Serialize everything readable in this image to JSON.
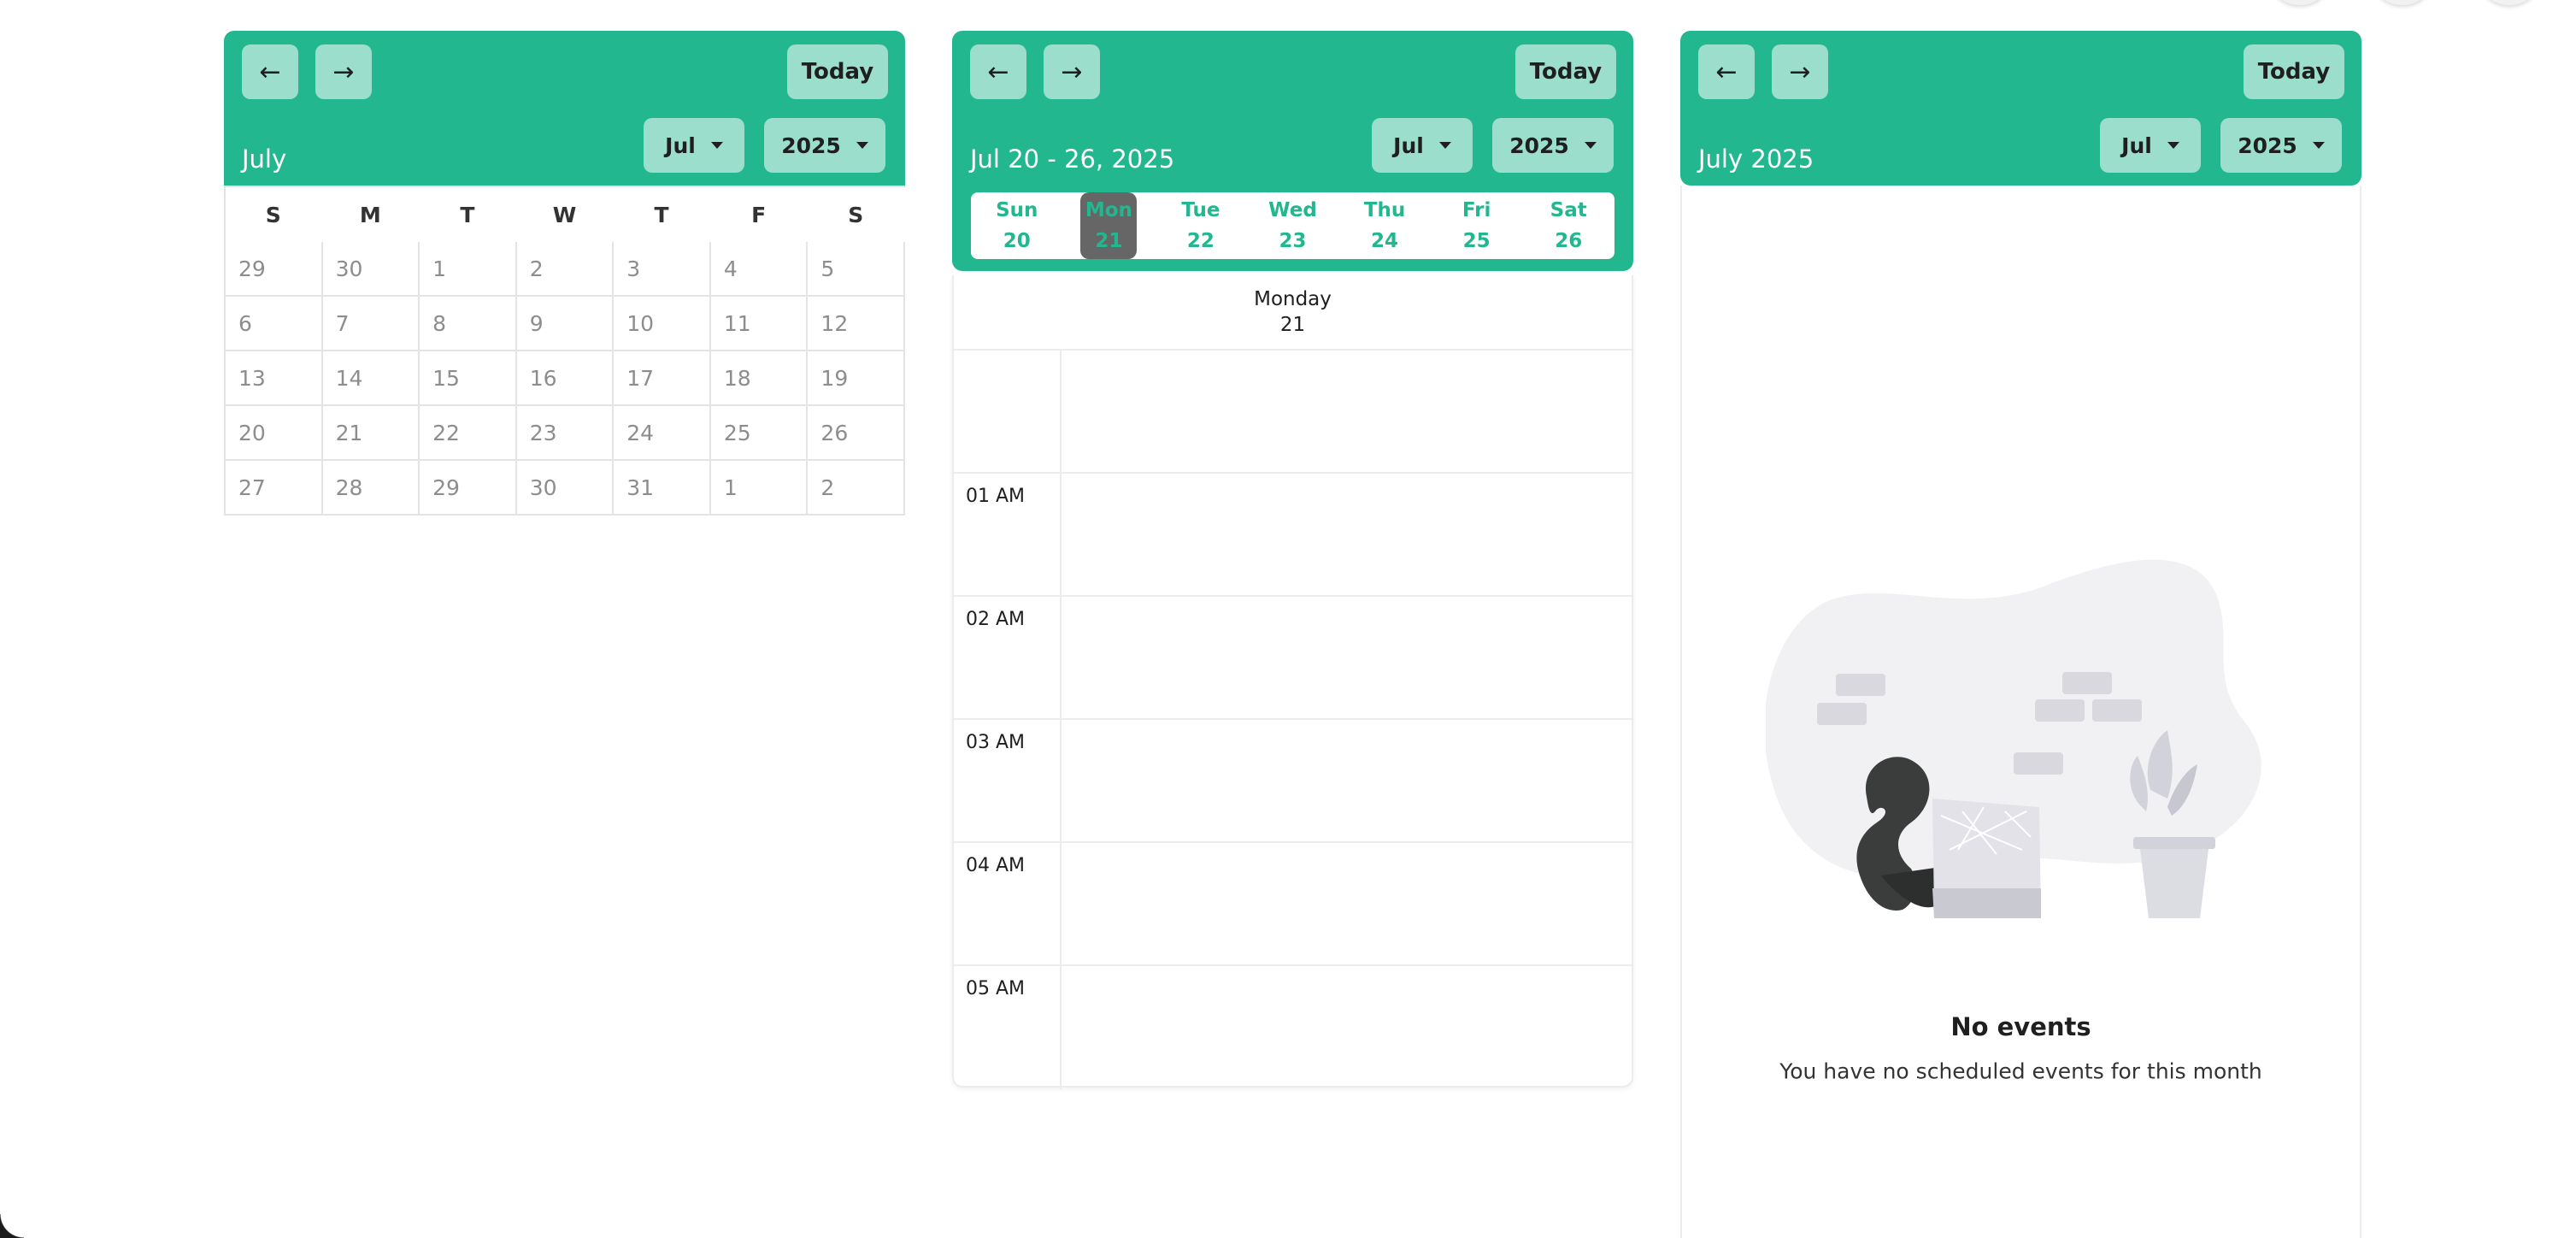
{
  "nav": {
    "prev_icon": "arrow-left-icon",
    "next_icon": "arrow-right-icon",
    "today_label": "Today"
  },
  "month_view": {
    "title": "July",
    "month_select": "Jul",
    "year_select": "2025",
    "weekday_headers": [
      "S",
      "M",
      "T",
      "W",
      "T",
      "F",
      "S"
    ],
    "weeks": [
      [
        "29",
        "30",
        "1",
        "2",
        "3",
        "4",
        "5"
      ],
      [
        "6",
        "7",
        "8",
        "9",
        "10",
        "11",
        "12"
      ],
      [
        "13",
        "14",
        "15",
        "16",
        "17",
        "18",
        "19"
      ],
      [
        "20",
        "21",
        "22",
        "23",
        "24",
        "25",
        "26"
      ],
      [
        "27",
        "28",
        "29",
        "30",
        "31",
        "1",
        "2"
      ]
    ]
  },
  "week_view": {
    "title": "Jul 20 - 26, 2025",
    "month_select": "Jul",
    "year_select": "2025",
    "days": [
      {
        "name": "Sun",
        "date": "20"
      },
      {
        "name": "Mon",
        "date": "21",
        "selected": true
      },
      {
        "name": "Tue",
        "date": "22"
      },
      {
        "name": "Wed",
        "date": "23"
      },
      {
        "name": "Thu",
        "date": "24"
      },
      {
        "name": "Fri",
        "date": "25"
      },
      {
        "name": "Sat",
        "date": "26"
      }
    ],
    "selected_day_name": "Monday",
    "selected_day_date": "21",
    "hours": [
      "",
      "01 AM",
      "02 AM",
      "03 AM",
      "04 AM",
      "05 AM"
    ]
  },
  "list_view": {
    "title": "July 2025",
    "month_select": "Jul",
    "year_select": "2025",
    "empty_title": "No events",
    "empty_subtitle": "You have no scheduled events for this month"
  },
  "colors": {
    "accent": "#22b78e",
    "selected_day": "#666666"
  }
}
